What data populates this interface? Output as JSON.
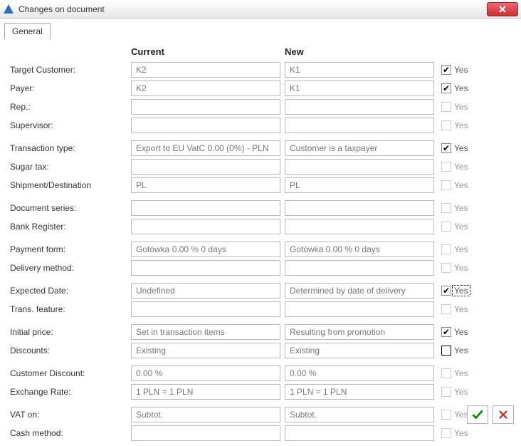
{
  "window": {
    "title": "Changes on document"
  },
  "tabs": {
    "general": "General"
  },
  "columns": {
    "current": "Current",
    "new": "New"
  },
  "yes_label": "Yes",
  "rows": [
    {
      "label": "Target Customer:",
      "current": "K2",
      "new": "K1",
      "checked": true
    },
    {
      "label": "Payer:",
      "current": "K2",
      "new": "K1",
      "checked": true
    },
    {
      "label": "Rep.:",
      "current": "",
      "new": "",
      "checked": false,
      "muted": true
    },
    {
      "label": "Supervisor:",
      "current": "",
      "new": "",
      "checked": false,
      "muted": true,
      "grpend": true
    },
    {
      "label": "Transaction type:",
      "current": "Export to EU VatC 0.00  (0%) - PLN",
      "new": "Customer is a taxpayer",
      "checked": true
    },
    {
      "label": "Sugar tax:",
      "current": "",
      "new": "",
      "checked": false,
      "muted": true
    },
    {
      "label": "Shipment/Destination",
      "current": "PL",
      "new": "PL",
      "checked": false,
      "muted": true,
      "grpend": true
    },
    {
      "label": "Document series:",
      "current": "",
      "new": "",
      "checked": false,
      "muted": true
    },
    {
      "label": "Bank Register:",
      "current": "",
      "new": "",
      "checked": false,
      "muted": true,
      "grpend": true
    },
    {
      "label": "Payment form:",
      "current": "Gotówka    0.00 % 0 days",
      "new": "Gotówka    0.00 % 0 days",
      "checked": false,
      "muted": true
    },
    {
      "label": "Delivery method:",
      "current": "",
      "new": "",
      "checked": false,
      "muted": true,
      "grpend": true
    },
    {
      "label": "Expected Date:",
      "current": "Undefined",
      "new": "Determined by date of delivery",
      "checked": true,
      "focus": true
    },
    {
      "label": "Trans. feature:",
      "current": "",
      "new": "",
      "checked": false,
      "muted": true,
      "grpend": true
    },
    {
      "label": "Initial price:",
      "current": "Set in transaction items",
      "new": "Resulting from promotion",
      "checked": true
    },
    {
      "label": "Discounts:",
      "current": "Existing",
      "new": "Existing",
      "checked": false,
      "bold": true,
      "grpend": true
    },
    {
      "label": "Customer Discount:",
      "current": "   0.00 %",
      "new": "   0.00 %",
      "checked": false,
      "muted": true
    },
    {
      "label": "Exchange Rate:",
      "current": "1 PLN = 1 PLN",
      "new": "1 PLN = 1 PLN",
      "checked": false,
      "muted": true,
      "grpend": true
    },
    {
      "label": "VAT on:",
      "current": "Subtot.",
      "new": "Subtot.",
      "checked": false,
      "muted": true
    },
    {
      "label": "Cash method:",
      "current": "",
      "new": "",
      "checked": false,
      "muted": true
    }
  ]
}
